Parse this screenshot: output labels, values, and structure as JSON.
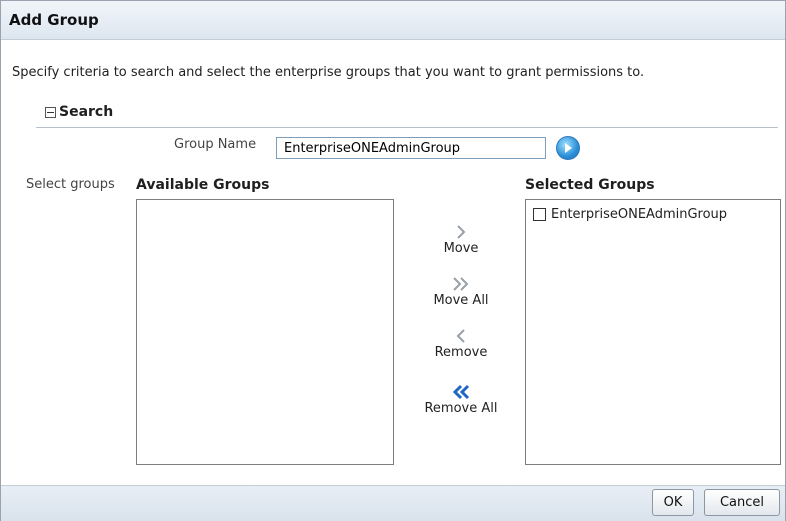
{
  "dialog": {
    "title": "Add Group"
  },
  "instructions": "Specify criteria to search and select the enterprise groups that you want to grant permissions to.",
  "search": {
    "label": "Search",
    "group_name_label": "Group Name",
    "group_name_value": "EnterpriseONEAdminGroup"
  },
  "shuttle": {
    "select_label": "Select groups",
    "available_title": "Available Groups",
    "selected_title": "Selected Groups",
    "available_items": [],
    "selected_items": [
      {
        "label": "EnterpriseONEAdminGroup",
        "checked": false
      }
    ],
    "move_label": "Move",
    "move_all_label": "Move All",
    "remove_label": "Remove",
    "remove_all_label": "Remove All"
  },
  "footer": {
    "ok_label": "OK",
    "cancel_label": "Cancel"
  },
  "colors": {
    "accent": "#2a8fd8",
    "title_bar": "#dde6f0",
    "footer": "#d9e2ec"
  }
}
